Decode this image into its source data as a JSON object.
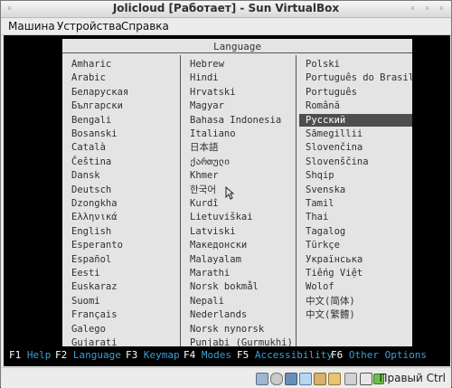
{
  "window": {
    "title": "Jolicloud [Работает] - Sun VirtualBox"
  },
  "menu": {
    "machine": "Машина",
    "devices": "Устройства",
    "help": "Справка"
  },
  "dialog": {
    "title": "Language",
    "columns": [
      [
        "Amharic",
        "Arabic",
        "Беларуская",
        "Български",
        "Bengali",
        "Bosanski",
        "Català",
        "Čeština",
        "Dansk",
        "Deutsch",
        "Dzongkha",
        "Ελληνικά",
        "English",
        "Esperanto",
        "Español",
        "Eesti",
        "Euskaraz",
        "Suomi",
        "Français",
        "Galego",
        "Gujarati"
      ],
      [
        "Hebrew",
        "Hindi",
        "Hrvatski",
        "Magyar",
        "Bahasa Indonesia",
        "Italiano",
        "日本語",
        "ქართული",
        "Khmer",
        "한국어",
        "Kurdî",
        "Lietuviškai",
        "Latviski",
        "Македонски",
        "Malayalam",
        "Marathi",
        "Norsk bokmål",
        "Nepali",
        "Nederlands",
        "Norsk nynorsk",
        "Punjabi (Gurmukhi)"
      ],
      [
        "Polski",
        "Português do Brasil",
        "Português",
        "Română",
        "Русский",
        "Sãmegillii",
        "Slovenčina",
        "Slovenščina",
        "Shqip",
        "Svenska",
        "Tamil",
        "Thai",
        "Tagalog",
        "Türkçe",
        "Українська",
        "Tiếng Việt",
        "Wolof",
        "中文(简体)",
        "中文(繁體)"
      ]
    ],
    "selected": "Русский"
  },
  "fkeys": [
    {
      "key": "F1",
      "label": "Help"
    },
    {
      "key": "F2",
      "label": "Language"
    },
    {
      "key": "F3",
      "label": "Keymap"
    },
    {
      "key": "F4",
      "label": "Modes"
    },
    {
      "key": "F5",
      "label": "Accessibility"
    },
    {
      "key": "F6",
      "label": "Other Options"
    }
  ],
  "statusbar": {
    "host_key": "Правый Ctrl",
    "icons": [
      "hard-disk-icon",
      "cd-icon",
      "floppy-icon",
      "network-icon",
      "usb-icon",
      "shared-folder-icon",
      "mouse-integration-icon",
      "vt-x-icon"
    ]
  }
}
